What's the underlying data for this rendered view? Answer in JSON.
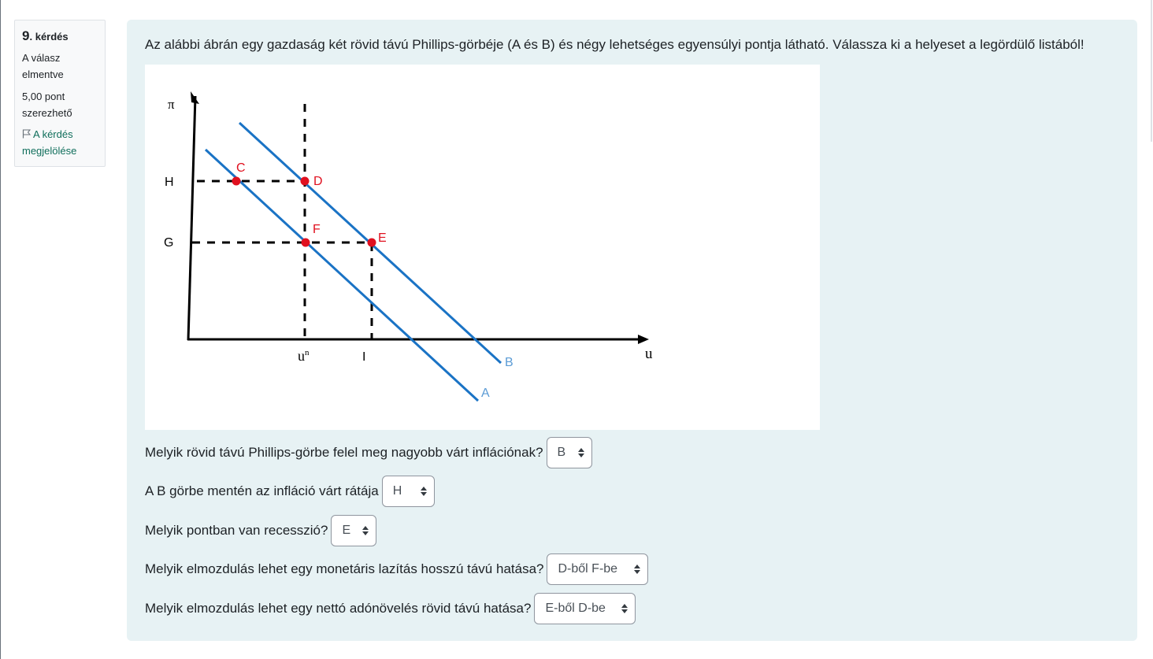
{
  "info": {
    "question_number": "9",
    "question_word": "kérdés",
    "state": "A válasz elmentve",
    "grade": "5,00 pont szerezhető",
    "flag_label": "A kérdés megjelölése"
  },
  "question": {
    "text": "Az alábbi ábrán egy gazdaság két rövid távú Phillips-görbéje (A és B) és négy lehetséges egyensúlyi pontja látható. Válassza ki a helyeset a legördülő listából!"
  },
  "figure": {
    "y_axis_label": "π",
    "x_axis_label": "u",
    "y_tick_H": "H",
    "y_tick_G": "G",
    "x_tick_un": "u",
    "x_tick_un_sup": "n",
    "x_tick_I": "I",
    "curve_A": "A",
    "curve_B": "B",
    "point_C": "C",
    "point_D": "D",
    "point_E": "E",
    "point_F": "F",
    "colors": {
      "curve": "#1a73c5",
      "point": "#e0101f",
      "axis": "#000000"
    }
  },
  "subquestions": [
    {
      "label": "Melyik rövid távú Phillips-görbe felel meg nagyobb várt inflációnak?",
      "selected": "B"
    },
    {
      "label": "A B görbe mentén az infláció várt rátája",
      "selected": "H"
    },
    {
      "label": "Melyik pontban van recesszió?",
      "selected": "E"
    },
    {
      "label": "Melyik elmozdulás lehet egy monetáris lazítás hosszú távú hatása?",
      "selected": "D-ből F-be"
    },
    {
      "label": "Melyik elmozdulás lehet egy nettó adónövelés rövid távú hatása?",
      "selected": "E-ből D-be"
    }
  ]
}
